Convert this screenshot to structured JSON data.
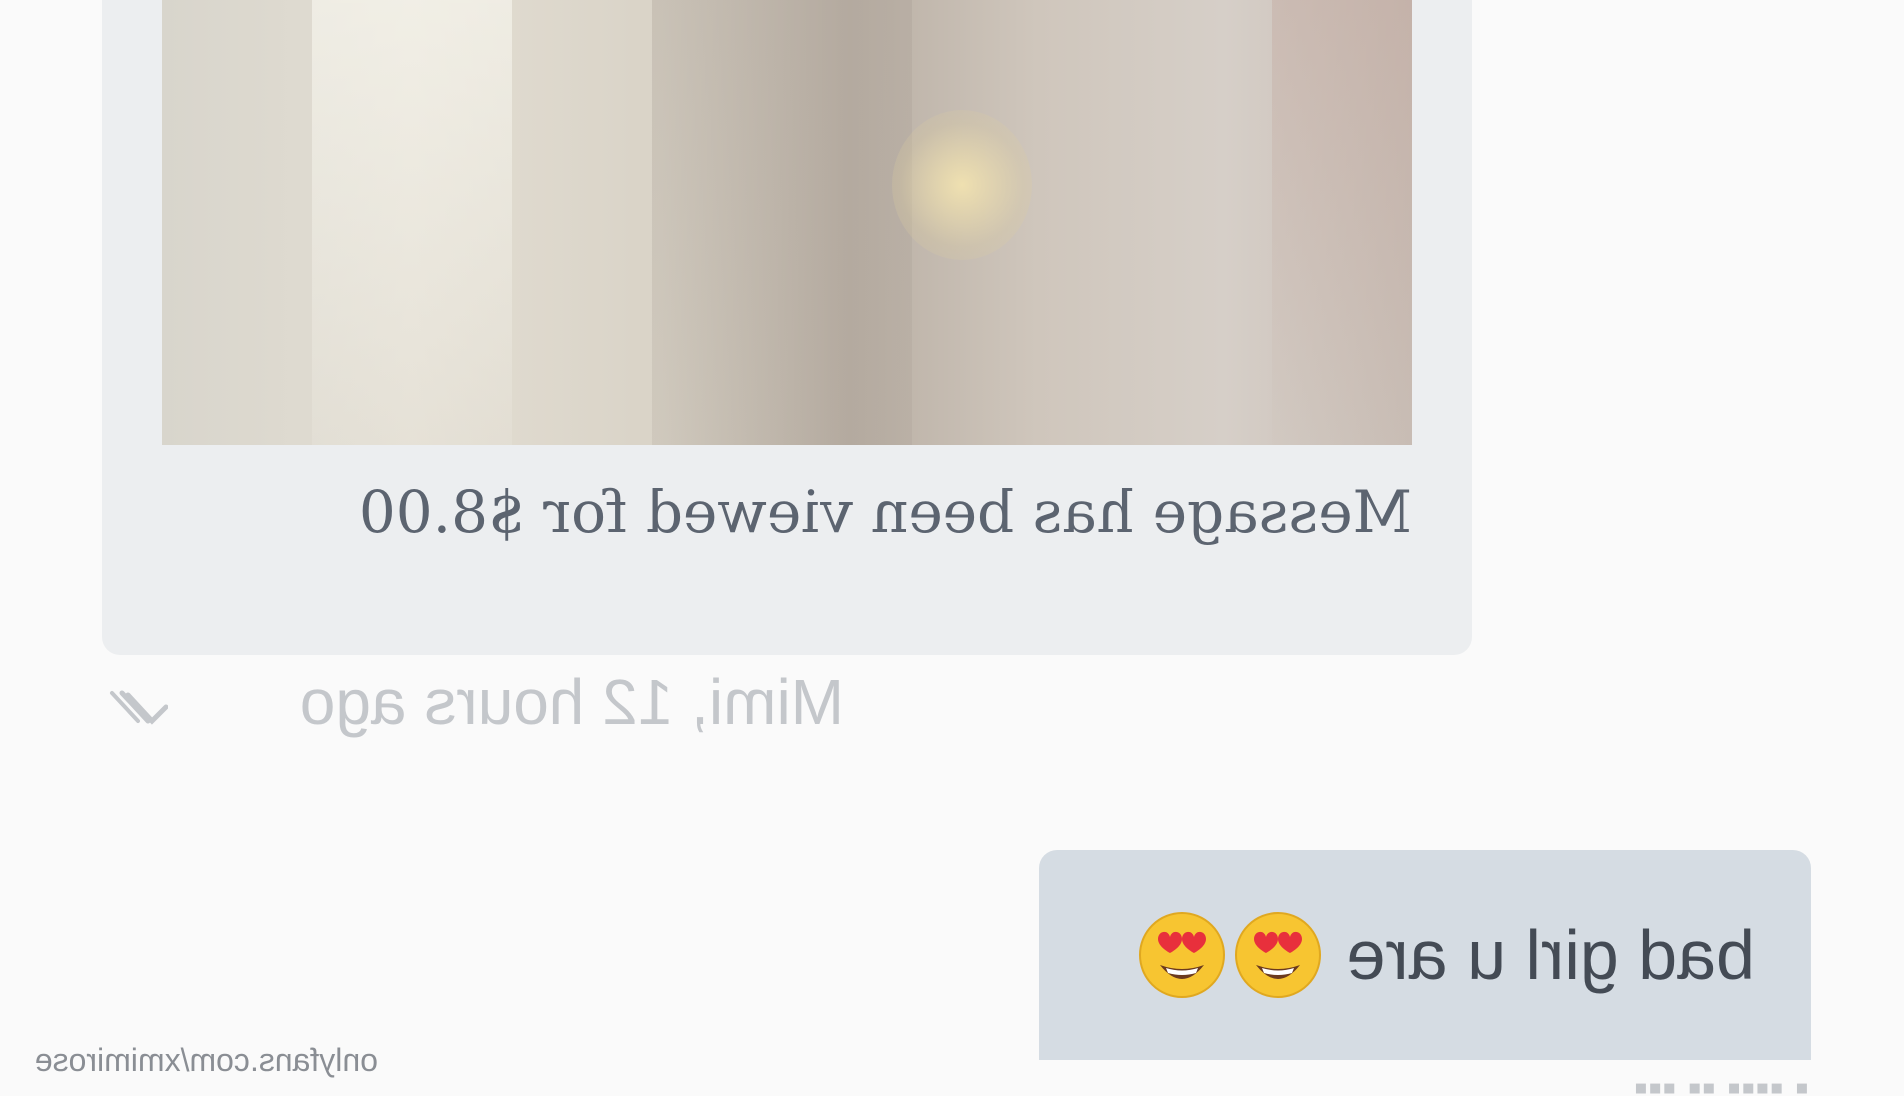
{
  "incoming_message": {
    "media": "blurred-photo",
    "caption": "Message has been viewed for $8.00",
    "meta": "Mimi, 12 hours ago",
    "read_icon": "double-check-icon"
  },
  "outgoing_message": {
    "text": "bad girl u are",
    "emojis": [
      "heart-eyes-emoji",
      "heart-eyes-emoji"
    ]
  },
  "watermark": "onlyfans.com/xmimirose",
  "colors": {
    "incoming_bubble": "#eceef0",
    "outgoing_bubble": "#d5dce3",
    "caption_text": "#5c6470",
    "meta_text": "#c4c7cb"
  }
}
